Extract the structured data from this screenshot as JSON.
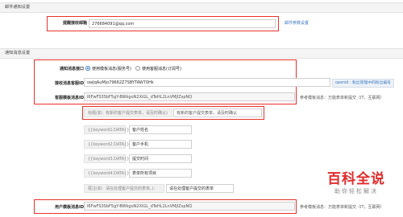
{
  "section1": {
    "title": "邮件通知设置"
  },
  "email": {
    "label": "提醒接收邮箱",
    "value": "276684091@qq.com",
    "settings_link": "邮件参数设置"
  },
  "section2": {
    "title": "通知消息设置"
  },
  "interface": {
    "label": "通知消息接口",
    "option1": "使用模板消息(服务号)",
    "option2": "使用客服消息(订阅号)",
    "selected": "option1"
  },
  "openid": {
    "label": "接收消息客服ID",
    "value": "owJqAuMjo79662Z7SBYTAW70Hk",
    "hint": "openid : 粉丝管理中的粉丝编号"
  },
  "template": {
    "label": "客服模板消息ID",
    "value": "l6FwFS3SbF5gY-BWkgoN2XiGL_dTeHL2LnVMJlZspNQ",
    "desc": "参考模板消息：万能表单新提交（IT，互联网）"
  },
  "fields": {
    "title_label": "标题(如：有新的客户提交表单，请及时确认)",
    "title_value": "有新的客户提交表单，请及时确认",
    "rows": [
      {
        "key": "{{keyword1.DATA}}：",
        "value": "客户姓名"
      },
      {
        "key": "{{keyword2.DATA}}：",
        "value": "客户手机"
      },
      {
        "key": "{{keyword3.DATA}}：",
        "value": "提交时间"
      },
      {
        "key": "{{keyword4.DATA}}：",
        "value": "表单所有项目"
      }
    ],
    "remark_label": "尾注(如：请在处理客户提交的表单。)：",
    "remark_value": "请在处理客户提交的表单"
  },
  "user_template": {
    "label": "用户模板消息ID",
    "value": "l6FwFS3SbF5gY-BWkgoN2XiGL_dTeHL2LnVMJlZspNQ",
    "desc": "参考模板消息：万能表单新提交（IT，互联网）"
  },
  "watermark": {
    "title": "百科全说",
    "subtitle": "助你轻松解决"
  },
  "colors": {
    "highlight": "#e8322b",
    "link": "#3a78c3"
  }
}
